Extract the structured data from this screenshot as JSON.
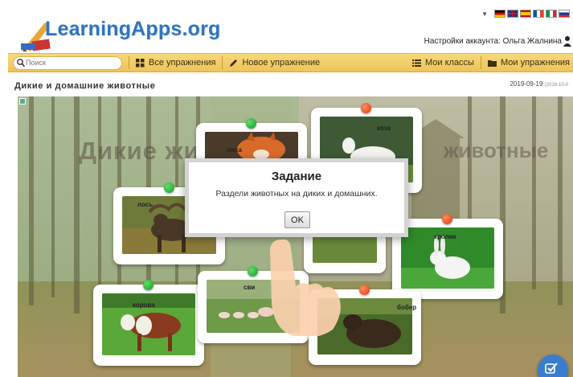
{
  "header": {
    "logo_text": "LearningApps.org",
    "account_text": "Настройки аккаунта: Ольга Жалнина",
    "language_flags": [
      "de-flag-icon",
      "uk-flag-icon",
      "es-flag-icon",
      "fr-flag-icon",
      "it-flag-icon",
      "ru-flag-icon"
    ]
  },
  "toolbar": {
    "search_placeholder": "Поиск",
    "all_exercises": "Все упражнения",
    "new_exercise": "Новое упражнение",
    "my_classes": "Мои классы",
    "my_exercises": "Мои упражнения"
  },
  "page": {
    "title": "Дикие и домашние животные",
    "date": "2019-09-19",
    "date_small": "(2018-10-0"
  },
  "stage": {
    "bg_title": "Дикие живо",
    "bg_title_right": "животные",
    "cards": [
      {
        "label": "лиса",
        "pin": "green"
      },
      {
        "label": "коза",
        "pin": "red"
      },
      {
        "label": "лось",
        "pin": "green"
      },
      {
        "label": "кролик",
        "pin": "red"
      },
      {
        "label": "корова",
        "pin": "green"
      },
      {
        "label": "сви",
        "pin": "green"
      },
      {
        "label": "бобер",
        "pin": "red"
      }
    ]
  },
  "dialog": {
    "title": "Задание",
    "text": "Раздели животных на диких и домашних.",
    "ok_label": "OK"
  },
  "colors": {
    "brand_blue": "#2f74c0",
    "toolbar_yellow": "#f2cc66",
    "pin_green": "#1a9a2a",
    "pin_red": "#e03b12",
    "check_button": "#3a7dd0"
  }
}
